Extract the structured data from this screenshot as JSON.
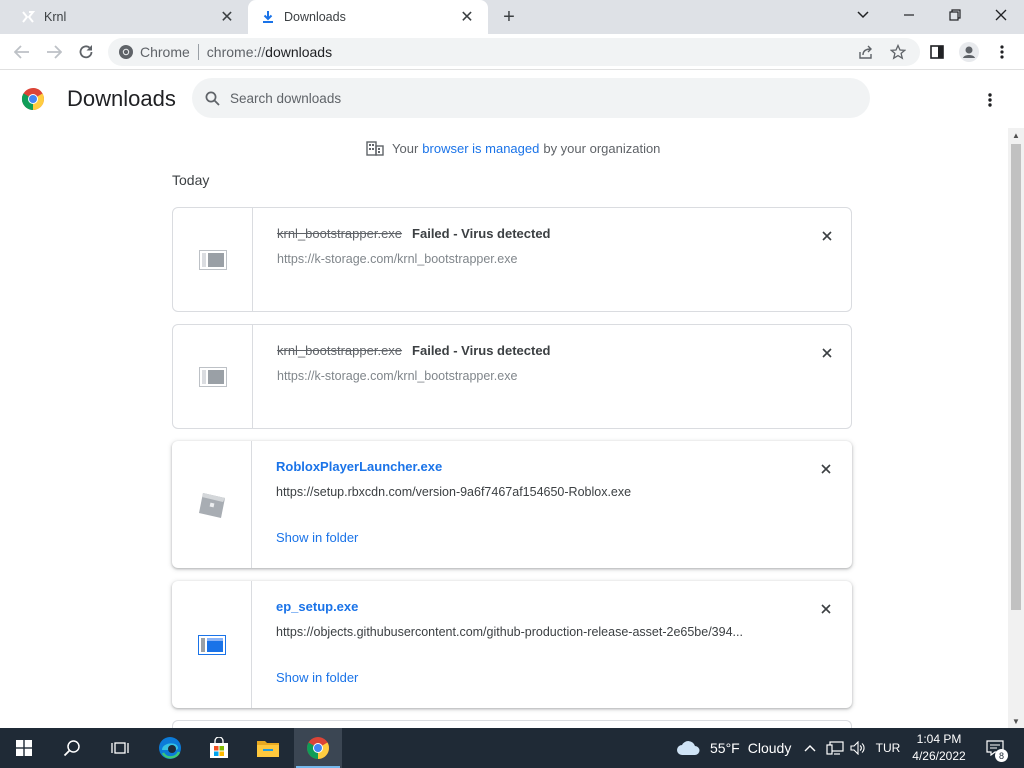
{
  "tabs": [
    {
      "title": "Krnl"
    },
    {
      "title": "Downloads"
    }
  ],
  "omnibox": {
    "chrome_label": "Chrome",
    "url_scheme": "chrome://",
    "url_host": "downloads"
  },
  "page": {
    "title": "Downloads",
    "search_placeholder": "Search downloads"
  },
  "managed": {
    "prefix": "Your",
    "link": "browser is managed",
    "suffix": "by your organization"
  },
  "section_label": "Today",
  "downloads": [
    {
      "filename": "krnl_bootstrapper.exe",
      "status": "Failed - Virus detected",
      "url": "https://k-storage.com/krnl_bootstrapper.exe",
      "icon": "file-icon"
    },
    {
      "filename": "krnl_bootstrapper.exe",
      "status": "Failed - Virus detected",
      "url": "https://k-storage.com/krnl_bootstrapper.exe",
      "icon": "file-icon"
    },
    {
      "filename": "RobloxPlayerLauncher.exe",
      "url": "https://setup.rbxcdn.com/version-9a6f7467af154650-Roblox.exe",
      "action": "Show in folder",
      "icon": "roblox-icon"
    },
    {
      "filename": "ep_setup.exe",
      "url": "https://objects.githubusercontent.com/github-production-release-asset-2e65be/394...",
      "action": "Show in folder",
      "icon": "installer-icon"
    }
  ],
  "taskbar": {
    "weather_temp": "55°F",
    "weather_text": "Cloudy",
    "language": "TUR",
    "time": "1:04 PM",
    "date": "4/26/2022",
    "notification_count": "8"
  },
  "colors": {
    "accent": "#1a73e8",
    "tabstrip": "#dee1e6",
    "taskbar": "#1f2a36"
  }
}
